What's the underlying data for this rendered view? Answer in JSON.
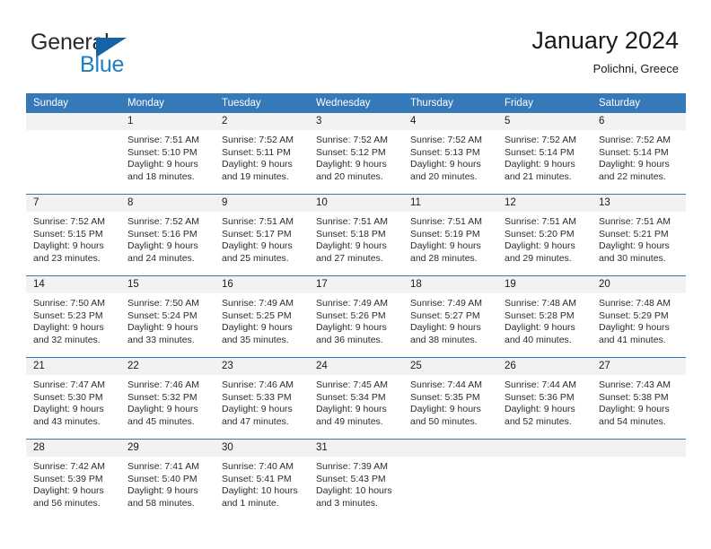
{
  "brand": {
    "name_part1": "General",
    "name_part2": "Blue",
    "triangle_color": "#1464a5",
    "blue_text_color": "#1f7dc2"
  },
  "header": {
    "title": "January 2024",
    "subtitle": "Polichni, Greece"
  },
  "theme": {
    "header_blue": "#3579b8",
    "band_gray": "#f2f2f2",
    "text_dark": "#1a1a1a"
  },
  "weekday_headers": [
    "Sunday",
    "Monday",
    "Tuesday",
    "Wednesday",
    "Thursday",
    "Friday",
    "Saturday"
  ],
  "weeks": [
    [
      {
        "day": "",
        "sunrise": "",
        "sunset": "",
        "daylight1": "",
        "daylight2": ""
      },
      {
        "day": "1",
        "sunrise": "Sunrise: 7:51 AM",
        "sunset": "Sunset: 5:10 PM",
        "daylight1": "Daylight: 9 hours",
        "daylight2": "and 18 minutes."
      },
      {
        "day": "2",
        "sunrise": "Sunrise: 7:52 AM",
        "sunset": "Sunset: 5:11 PM",
        "daylight1": "Daylight: 9 hours",
        "daylight2": "and 19 minutes."
      },
      {
        "day": "3",
        "sunrise": "Sunrise: 7:52 AM",
        "sunset": "Sunset: 5:12 PM",
        "daylight1": "Daylight: 9 hours",
        "daylight2": "and 20 minutes."
      },
      {
        "day": "4",
        "sunrise": "Sunrise: 7:52 AM",
        "sunset": "Sunset: 5:13 PM",
        "daylight1": "Daylight: 9 hours",
        "daylight2": "and 20 minutes."
      },
      {
        "day": "5",
        "sunrise": "Sunrise: 7:52 AM",
        "sunset": "Sunset: 5:14 PM",
        "daylight1": "Daylight: 9 hours",
        "daylight2": "and 21 minutes."
      },
      {
        "day": "6",
        "sunrise": "Sunrise: 7:52 AM",
        "sunset": "Sunset: 5:14 PM",
        "daylight1": "Daylight: 9 hours",
        "daylight2": "and 22 minutes."
      }
    ],
    [
      {
        "day": "7",
        "sunrise": "Sunrise: 7:52 AM",
        "sunset": "Sunset: 5:15 PM",
        "daylight1": "Daylight: 9 hours",
        "daylight2": "and 23 minutes."
      },
      {
        "day": "8",
        "sunrise": "Sunrise: 7:52 AM",
        "sunset": "Sunset: 5:16 PM",
        "daylight1": "Daylight: 9 hours",
        "daylight2": "and 24 minutes."
      },
      {
        "day": "9",
        "sunrise": "Sunrise: 7:51 AM",
        "sunset": "Sunset: 5:17 PM",
        "daylight1": "Daylight: 9 hours",
        "daylight2": "and 25 minutes."
      },
      {
        "day": "10",
        "sunrise": "Sunrise: 7:51 AM",
        "sunset": "Sunset: 5:18 PM",
        "daylight1": "Daylight: 9 hours",
        "daylight2": "and 27 minutes."
      },
      {
        "day": "11",
        "sunrise": "Sunrise: 7:51 AM",
        "sunset": "Sunset: 5:19 PM",
        "daylight1": "Daylight: 9 hours",
        "daylight2": "and 28 minutes."
      },
      {
        "day": "12",
        "sunrise": "Sunrise: 7:51 AM",
        "sunset": "Sunset: 5:20 PM",
        "daylight1": "Daylight: 9 hours",
        "daylight2": "and 29 minutes."
      },
      {
        "day": "13",
        "sunrise": "Sunrise: 7:51 AM",
        "sunset": "Sunset: 5:21 PM",
        "daylight1": "Daylight: 9 hours",
        "daylight2": "and 30 minutes."
      }
    ],
    [
      {
        "day": "14",
        "sunrise": "Sunrise: 7:50 AM",
        "sunset": "Sunset: 5:23 PM",
        "daylight1": "Daylight: 9 hours",
        "daylight2": "and 32 minutes."
      },
      {
        "day": "15",
        "sunrise": "Sunrise: 7:50 AM",
        "sunset": "Sunset: 5:24 PM",
        "daylight1": "Daylight: 9 hours",
        "daylight2": "and 33 minutes."
      },
      {
        "day": "16",
        "sunrise": "Sunrise: 7:49 AM",
        "sunset": "Sunset: 5:25 PM",
        "daylight1": "Daylight: 9 hours",
        "daylight2": "and 35 minutes."
      },
      {
        "day": "17",
        "sunrise": "Sunrise: 7:49 AM",
        "sunset": "Sunset: 5:26 PM",
        "daylight1": "Daylight: 9 hours",
        "daylight2": "and 36 minutes."
      },
      {
        "day": "18",
        "sunrise": "Sunrise: 7:49 AM",
        "sunset": "Sunset: 5:27 PM",
        "daylight1": "Daylight: 9 hours",
        "daylight2": "and 38 minutes."
      },
      {
        "day": "19",
        "sunrise": "Sunrise: 7:48 AM",
        "sunset": "Sunset: 5:28 PM",
        "daylight1": "Daylight: 9 hours",
        "daylight2": "and 40 minutes."
      },
      {
        "day": "20",
        "sunrise": "Sunrise: 7:48 AM",
        "sunset": "Sunset: 5:29 PM",
        "daylight1": "Daylight: 9 hours",
        "daylight2": "and 41 minutes."
      }
    ],
    [
      {
        "day": "21",
        "sunrise": "Sunrise: 7:47 AM",
        "sunset": "Sunset: 5:30 PM",
        "daylight1": "Daylight: 9 hours",
        "daylight2": "and 43 minutes."
      },
      {
        "day": "22",
        "sunrise": "Sunrise: 7:46 AM",
        "sunset": "Sunset: 5:32 PM",
        "daylight1": "Daylight: 9 hours",
        "daylight2": "and 45 minutes."
      },
      {
        "day": "23",
        "sunrise": "Sunrise: 7:46 AM",
        "sunset": "Sunset: 5:33 PM",
        "daylight1": "Daylight: 9 hours",
        "daylight2": "and 47 minutes."
      },
      {
        "day": "24",
        "sunrise": "Sunrise: 7:45 AM",
        "sunset": "Sunset: 5:34 PM",
        "daylight1": "Daylight: 9 hours",
        "daylight2": "and 49 minutes."
      },
      {
        "day": "25",
        "sunrise": "Sunrise: 7:44 AM",
        "sunset": "Sunset: 5:35 PM",
        "daylight1": "Daylight: 9 hours",
        "daylight2": "and 50 minutes."
      },
      {
        "day": "26",
        "sunrise": "Sunrise: 7:44 AM",
        "sunset": "Sunset: 5:36 PM",
        "daylight1": "Daylight: 9 hours",
        "daylight2": "and 52 minutes."
      },
      {
        "day": "27",
        "sunrise": "Sunrise: 7:43 AM",
        "sunset": "Sunset: 5:38 PM",
        "daylight1": "Daylight: 9 hours",
        "daylight2": "and 54 minutes."
      }
    ],
    [
      {
        "day": "28",
        "sunrise": "Sunrise: 7:42 AM",
        "sunset": "Sunset: 5:39 PM",
        "daylight1": "Daylight: 9 hours",
        "daylight2": "and 56 minutes."
      },
      {
        "day": "29",
        "sunrise": "Sunrise: 7:41 AM",
        "sunset": "Sunset: 5:40 PM",
        "daylight1": "Daylight: 9 hours",
        "daylight2": "and 58 minutes."
      },
      {
        "day": "30",
        "sunrise": "Sunrise: 7:40 AM",
        "sunset": "Sunset: 5:41 PM",
        "daylight1": "Daylight: 10 hours",
        "daylight2": "and 1 minute."
      },
      {
        "day": "31",
        "sunrise": "Sunrise: 7:39 AM",
        "sunset": "Sunset: 5:43 PM",
        "daylight1": "Daylight: 10 hours",
        "daylight2": "and 3 minutes."
      },
      {
        "day": "",
        "sunrise": "",
        "sunset": "",
        "daylight1": "",
        "daylight2": ""
      },
      {
        "day": "",
        "sunrise": "",
        "sunset": "",
        "daylight1": "",
        "daylight2": ""
      },
      {
        "day": "",
        "sunrise": "",
        "sunset": "",
        "daylight1": "",
        "daylight2": ""
      }
    ]
  ]
}
